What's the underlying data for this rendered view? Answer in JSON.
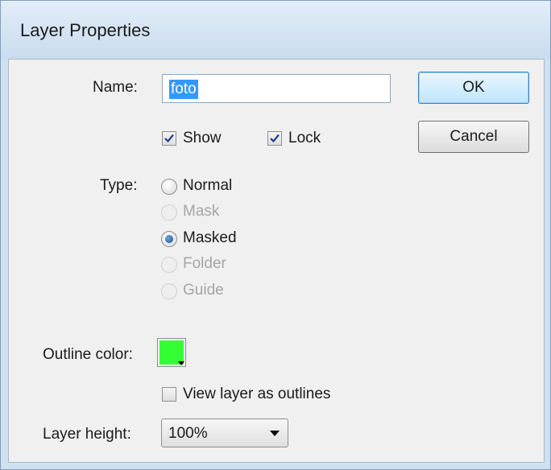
{
  "window": {
    "title": "Layer Properties"
  },
  "name": {
    "label": "Name:",
    "value": "foto"
  },
  "buttons": {
    "ok": "OK",
    "cancel": "Cancel"
  },
  "checkboxes": {
    "show": {
      "label": "Show",
      "checked": true
    },
    "lock": {
      "label": "Lock",
      "checked": true
    }
  },
  "type": {
    "label": "Type:",
    "options": [
      {
        "label": "Normal",
        "selected": false,
        "enabled": true
      },
      {
        "label": "Mask",
        "selected": false,
        "enabled": false
      },
      {
        "label": "Masked",
        "selected": true,
        "enabled": true
      },
      {
        "label": "Folder",
        "selected": false,
        "enabled": false
      },
      {
        "label": "Guide",
        "selected": false,
        "enabled": false
      }
    ]
  },
  "outline": {
    "label": "Outline color:",
    "color": "#33ff33"
  },
  "view_outlines": {
    "label": "View layer as outlines",
    "checked": false
  },
  "layer_height": {
    "label": "Layer height:",
    "value": "100%"
  },
  "colors": {
    "selection": "#3399ff",
    "accent_border": "#3c7fb1"
  }
}
